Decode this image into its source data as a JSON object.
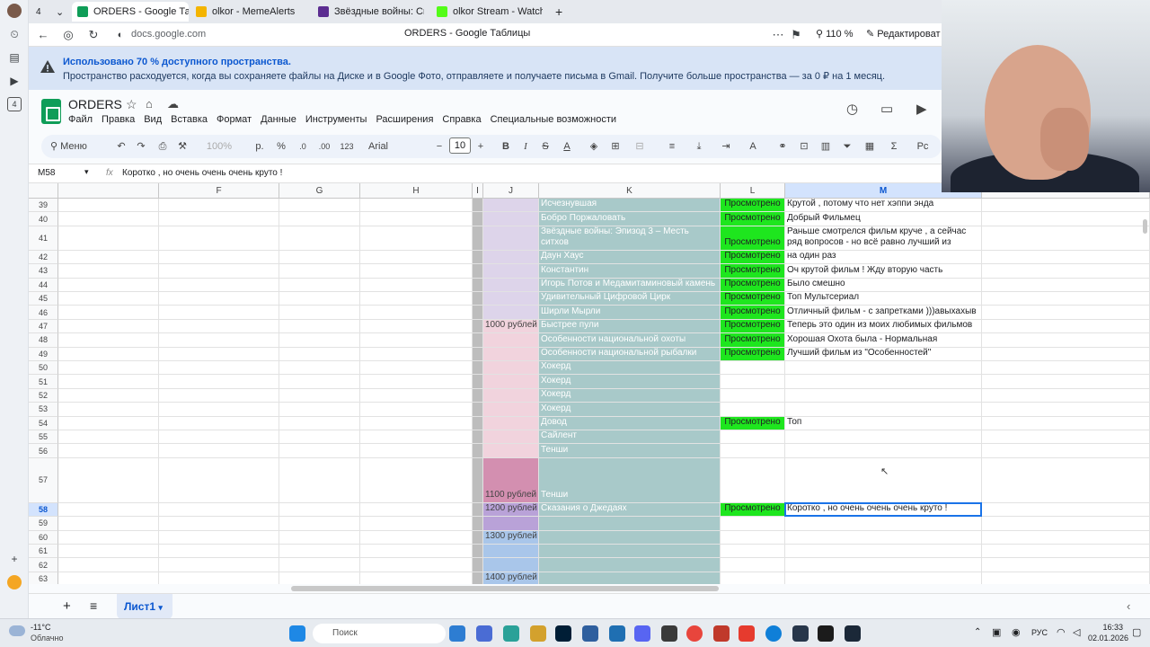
{
  "browser": {
    "tab_count": "4",
    "tabs": [
      {
        "label": "ORDERS - Google Табли",
        "color": "#0f9d58"
      },
      {
        "label": "olkor - MemeAlerts",
        "color": "#f4b400"
      },
      {
        "label": "Звёздные войны: Сказани",
        "color": "#5c2d91"
      },
      {
        "label": "olkor Stream - Watch Live",
        "color": "#53fc18"
      }
    ],
    "url": "docs.google.com",
    "page_title": "ORDERS - Google Таблицы",
    "zoom": "110 %",
    "edit_label": "Редактироват"
  },
  "banner": {
    "line1": "Использовано 70 % доступного пространства.",
    "line2": "Пространство расходуется, когда вы сохраняете файлы на Диске и в Google Фото, отправляете и получаете письма в Gmail. Получите больше пространства — за 0 ₽ на 1 месяц."
  },
  "doc": {
    "title": "ORDERS",
    "menus": [
      "Файл",
      "Правка",
      "Вид",
      "Вставка",
      "Формат",
      "Данные",
      "Инструменты",
      "Расширения",
      "Справка",
      "Специальные возможности"
    ]
  },
  "toolbar": {
    "menu_label": "Меню",
    "zoom": "100%",
    "currency": "р.",
    "percent": "%",
    "dec_minus": ".0",
    "dec_plus": ".00",
    "number_format": "123",
    "font": "Arial",
    "font_size": "10"
  },
  "formula_bar": {
    "name_box": "M58",
    "fx": "fx",
    "content": "Коротко , но очень очень очень круто !"
  },
  "columns": [
    "F",
    "G",
    "H",
    "I",
    "J",
    "K",
    "L",
    "M"
  ],
  "rows": [
    {
      "n": "39",
      "j": "",
      "k": "Исчезнувшая",
      "l": "Просмотрено",
      "m": "Крутой , потому что нет хэппи энда"
    },
    {
      "n": "40",
      "j": "",
      "k": "Бобро Поржаловать",
      "l": "Просмотрено",
      "m": "Добрый Фильмец"
    },
    {
      "n": "41",
      "j": "",
      "k": "Звёздные войны: Эпизод 3 – Месть ситхов",
      "l": "Просмотрено",
      "m": "Раньше смотрелся фильм круче , а сейчас ряд вопросов - но всё равно лучший из приквелов"
    },
    {
      "n": "42",
      "j": "",
      "k": "Даун Хаус",
      "l": "Просмотрено",
      "m": "на один раз"
    },
    {
      "n": "43",
      "j": "",
      "k": "Константин",
      "l": "Просмотрено",
      "m": "Оч крутой фильм ! Жду вторую часть"
    },
    {
      "n": "44",
      "j": "",
      "k": "Игорь Потов и Медамитаминовый камень",
      "l": "Просмотрено",
      "m": "Было смешно"
    },
    {
      "n": "45",
      "j": "",
      "k": "Удивительный Цифровой Цирк",
      "l": "Просмотрено",
      "m": "Топ Мультсериал"
    },
    {
      "n": "46",
      "j": "",
      "k": "Ширли Мырли",
      "l": "Просмотрено",
      "m": "Отличный фильм - с запретками )))авыхахыв"
    },
    {
      "n": "47",
      "j": "1000 рублей",
      "k": "Быстрее пули",
      "l": "Просмотрено",
      "m": "Теперь это один из моих любимых фильмов"
    },
    {
      "n": "48",
      "j": "",
      "k": "Особенности национальной охоты",
      "l": "Просмотрено",
      "m": "Хорошая Охота была - Нормальная"
    },
    {
      "n": "49",
      "j": "",
      "k": "Особенности национальной рыбалки",
      "l": "Просмотрено",
      "m": "Лучший фильм из \"Особенностей\""
    },
    {
      "n": "50",
      "j": "",
      "k": "Хокерд",
      "l": "",
      "m": ""
    },
    {
      "n": "51",
      "j": "",
      "k": "Хокерд",
      "l": "",
      "m": ""
    },
    {
      "n": "52",
      "j": "",
      "k": "Хокерд",
      "l": "",
      "m": ""
    },
    {
      "n": "53",
      "j": "",
      "k": "Хокерд",
      "l": "",
      "m": ""
    },
    {
      "n": "54",
      "j": "",
      "k": "Довод",
      "l": "Просмотрено",
      "m": "Топ"
    },
    {
      "n": "55",
      "j": "",
      "k": "Сайлент",
      "l": "",
      "m": ""
    },
    {
      "n": "56",
      "j": "",
      "k": "Тенши",
      "l": "",
      "m": ""
    },
    {
      "n": "57",
      "j": "1100 рублей",
      "k": "Тенши",
      "l": "",
      "m": ""
    },
    {
      "n": "58",
      "j": "1200 рублей",
      "k": "Сказания о Джедаях",
      "l": "Просмотрено",
      "m": "Коротко , но очень очень очень круто !"
    },
    {
      "n": "59",
      "j": "",
      "k": "",
      "l": "",
      "m": ""
    },
    {
      "n": "60",
      "j": "1300 рублей",
      "k": "",
      "l": "",
      "m": ""
    },
    {
      "n": "61",
      "j": "",
      "k": "",
      "l": "",
      "m": ""
    },
    {
      "n": "62",
      "j": "",
      "k": "",
      "l": "",
      "m": ""
    },
    {
      "n": "63",
      "j": "1400 рублей",
      "k": "",
      "l": "",
      "m": ""
    }
  ],
  "colors": {
    "k_fill": "#a8c9c9",
    "l_fill": "#1ee61e",
    "j_lavender": "#ddd4ea",
    "j_pink": "#f1d3dd",
    "j_rose": "#d38fb0",
    "j_purple": "#b9a2d8",
    "j_blue": "#a9c6ea",
    "i_fill": "#bdbdbd",
    "accent": "#1a73e8"
  },
  "sheet": {
    "name": "Лист1"
  },
  "taskbar": {
    "weather_temp": "-11°C",
    "weather_desc": "Облачно",
    "search": "Поиск",
    "lang": "РУС",
    "time": "16:33",
    "date": "02.01.2026"
  }
}
